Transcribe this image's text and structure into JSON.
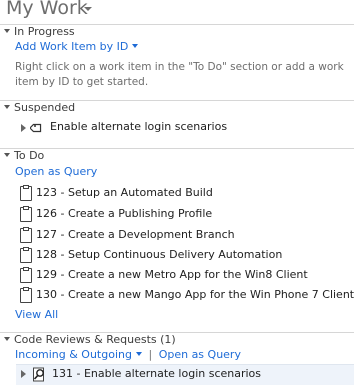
{
  "header": {
    "title": "My Work"
  },
  "in_progress": {
    "title": "In Progress",
    "add_link": "Add Work Item by ID",
    "help": "Right click on a work item in the \"To Do\" section or add a work item by ID to get started."
  },
  "suspended": {
    "title": "Suspended",
    "item": "Enable alternate login scenarios"
  },
  "todo": {
    "title": "To Do",
    "open_query": "Open as Query",
    "items": [
      "123 - Setup an Automated Build",
      "126 - Create a Publishing Profile",
      "127 - Create a Development Branch",
      "128 - Setup Continuous Delivery Automation",
      "129 - Create a new Metro App for the Win8 Client",
      "130 - Create a new Mango App for the Win Phone 7 Client"
    ],
    "view_all": "View All"
  },
  "code_reviews": {
    "title": "Code Reviews & Requests (1)",
    "filter": "Incoming & Outgoing",
    "separator": "|",
    "open_query": "Open as Query",
    "item": "131 - Enable alternate login scenarios"
  }
}
